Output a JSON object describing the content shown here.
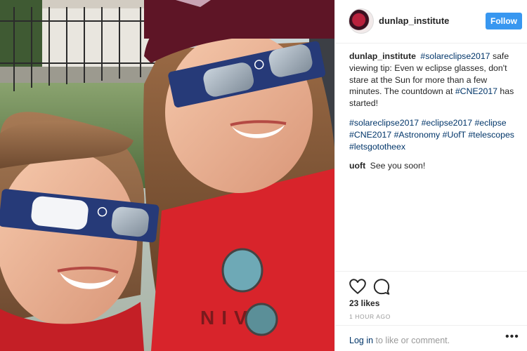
{
  "post": {
    "username": "dunlap_institute",
    "follow_label": "Follow",
    "caption": {
      "user": "dunlap_institute",
      "parts": [
        {
          "text": "#solareclipse2017",
          "tag": true
        },
        {
          "text": " safe viewing tip: Even w eclipse glasses, don't stare at the Sun for more than a few minutes. The countdown at ",
          "tag": false
        },
        {
          "text": "#CNE2017",
          "tag": true
        },
        {
          "text": " has started!",
          "tag": false
        }
      ]
    },
    "hashtag_comment": {
      "parts": [
        {
          "text": "#solareclipse2017",
          "tag": true
        },
        {
          "text": " ",
          "tag": false
        },
        {
          "text": "#eclipse2017",
          "tag": true
        },
        {
          "text": " ",
          "tag": false
        },
        {
          "text": "#eclipse",
          "tag": true
        },
        {
          "text": " ",
          "tag": false
        },
        {
          "text": "#CNE2017",
          "tag": true
        },
        {
          "text": " ",
          "tag": false
        },
        {
          "text": "#Astronomy",
          "tag": true
        },
        {
          "text": " ",
          "tag": false
        },
        {
          "text": "#UofT",
          "tag": true
        },
        {
          "text": " ",
          "tag": false
        },
        {
          "text": "#telescopes",
          "tag": true
        },
        {
          "text": " ",
          "tag": false
        },
        {
          "text": "#letsgototheex",
          "tag": true
        }
      ]
    },
    "reply": {
      "user": "uoft",
      "text": "See you soon!"
    },
    "likes": "23 likes",
    "time_ago": "1 HOUR AGO",
    "login": {
      "link": "Log in",
      "rest": " to like or comment."
    }
  },
  "icons": {
    "avatar": "eclipse-avatar",
    "like": "heart-icon",
    "comment": "comment-bubble-icon",
    "more": "more-options-icon"
  },
  "colors": {
    "follow_button": "#3897f0",
    "hashtag": "#003569",
    "muted": "#999999"
  }
}
